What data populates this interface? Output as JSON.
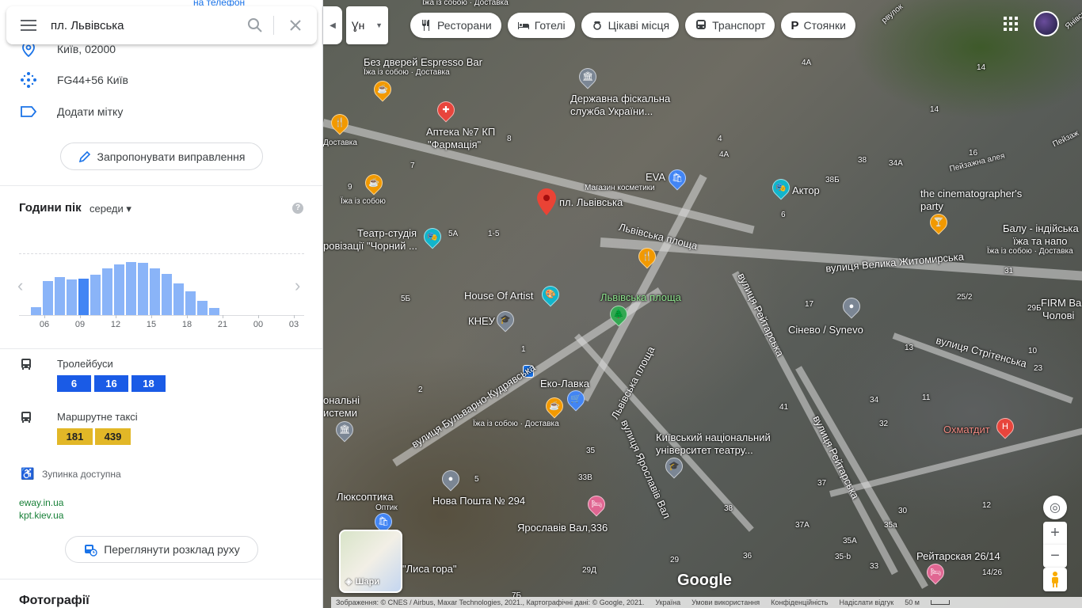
{
  "search": {
    "query": "пл. Львівська"
  },
  "top_link": "на телефон",
  "info": {
    "address": "Київ, 02000",
    "plus_code": "FG44+56 Київ",
    "add_label": "Додати мітку",
    "suggest_edit": "Запропонувати виправлення"
  },
  "popular_times": {
    "title": "Години пік",
    "day": "середи",
    "help": "?",
    "bars": [
      0,
      0.13,
      0.55,
      0.61,
      0.58,
      0.59,
      0.66,
      0.76,
      0.82,
      0.86,
      0.84,
      0.76,
      0.67,
      0.51,
      0.38,
      0.23,
      0.11,
      0.0,
      0,
      0,
      0,
      0,
      0
    ],
    "current_index": 5,
    "ticks": [
      "06",
      "09",
      "12",
      "15",
      "18",
      "21",
      "00",
      "03"
    ]
  },
  "transit": {
    "trolley_label": "Тролейбуси",
    "trolley_routes": [
      "6",
      "16",
      "18"
    ],
    "minibus_label": "Маршрутне таксі",
    "minibus_routes": [
      "181",
      "439"
    ],
    "accessible": "Зупинка доступна"
  },
  "links": [
    "eway.in.ua",
    "kpt.kiev.ua"
  ],
  "schedule_button": "Переглянути розклад руху",
  "photos_title": "Фотографії",
  "lang_toggle": "Ɣн",
  "categories": [
    "Ресторани",
    "Готелі",
    "Цікаві місця",
    "Транспорт",
    "Стоянки"
  ],
  "map_labels": {
    "pin_main": "пл. Львівська",
    "espresso": "Без дверей Espresso Bar",
    "espresso_sub": "Їжа із собою · Доставка",
    "top_sub": "Їжа із собою · Доставка",
    "apteka1": "Аптека №7 КП",
    "apteka2": "\"Фармація\"",
    "dfs1": "Державна фіскальна",
    "dfs2": "служба України...",
    "eva": "EVA",
    "eva_sub": "Магазин косметики",
    "aktor": "Актор",
    "cine1": "the cinematographer's",
    "cine2": "party",
    "balu1": "Балу - індійська",
    "balu2": "їжа та напо",
    "balu_sub": "Їжа із собою · Доставка",
    "teatr1": "Театр-студія",
    "teatr2": "ровізації \"Чорний ...",
    "teatr_sub": "Їжа із собою",
    "lviv_sq_street": "Львівська площа",
    "zhytomyrska": "вулиця Велика Житомирська",
    "house_artist": "House Of Artist",
    "kneu": "КНЕУ",
    "lviv_sq_green": "Львівська площа",
    "synevo": "Сінево / Synevo",
    "firm1": "FIRM Ba",
    "firm2": "Чолові",
    "strit": "вулиця Стрітенська",
    "reitarska": "вулиця Рейтарська",
    "reitarska2": "вулиця Рейтарська",
    "eko": "Еко-Лавка",
    "eko_sub": "Їжа із собою · Доставка",
    "kudr": "вулиця Бульварно-Кудрявська",
    "lviv_sq2": "Львівська площа",
    "yar_val": "вулиця Ярославів Вал",
    "knu1": "Київський національний",
    "knu2": "університет театру...",
    "okhm": "Охматдит",
    "nal1": "ональні",
    "nal2": "истеми",
    "lux": "Люксоптика",
    "lux_sub": "Оптик",
    "nova": "Нова Пошта № 294",
    "yar336": "Ярославів Вал,336",
    "reit2614": "Рейтарская 26/14",
    "lysa": "\"Лиса гора\"",
    "peyzh": "Пейзажна алея",
    "peyzh2": "Пейзаж",
    "dostavka": "Доставка",
    "dostavka_top": "Їжа із собою · Доставка",
    "vulyk": "рвулок",
    "yanivs": "Янівсь"
  },
  "house_numbers": [
    "8",
    "4",
    "4A",
    "14",
    "38Б",
    "38",
    "34A",
    "7",
    "9",
    "5A",
    "1-5",
    "5Б",
    "6",
    "17",
    "25/2",
    "29Б",
    "31",
    "13",
    "10",
    "1",
    "2",
    "35",
    "33В",
    "5",
    "41",
    "34",
    "32",
    "11",
    "37",
    "38",
    "37A",
    "35а",
    "35A",
    "36",
    "35-b",
    "33",
    "30",
    "12",
    "14/26",
    "14",
    "29Д",
    "29",
    "7Б",
    "4A",
    "16",
    "23"
  ],
  "layers_label": "Шари",
  "footer": [
    "Зображення: © CNES / Airbus, Maxar Technologies, 2021., Картографічні дані: © Google, 2021.",
    "Україна",
    "Умови використання",
    "Конфіденційність",
    "Надіслати відгук",
    "50 м"
  ],
  "google_logo": "Google"
}
